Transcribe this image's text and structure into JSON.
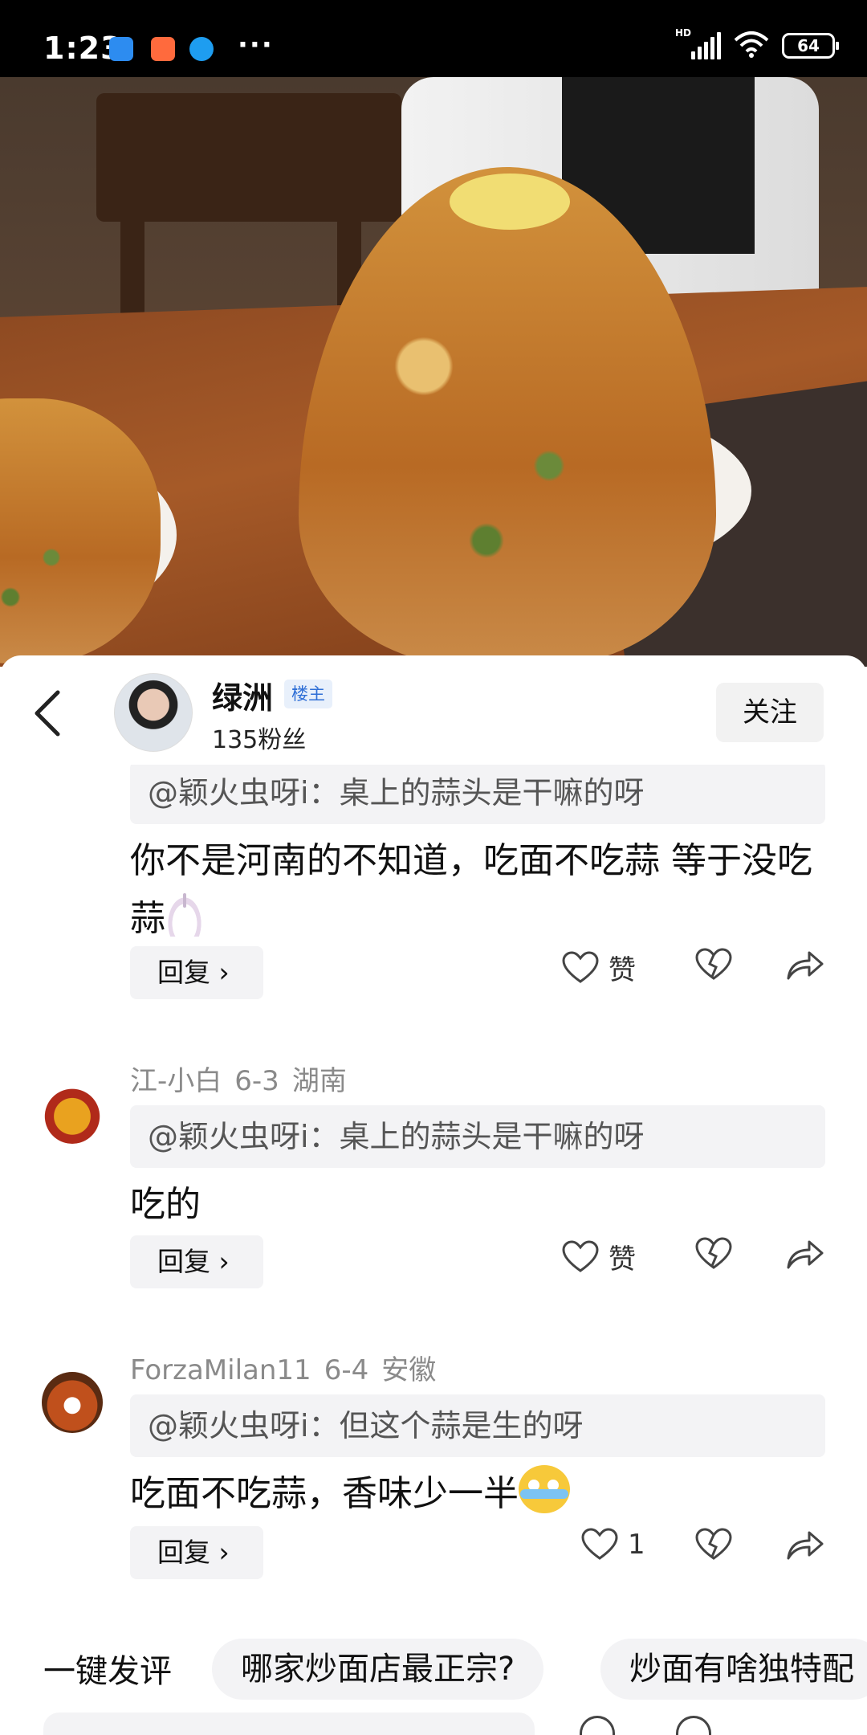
{
  "status_bar": {
    "time": "1:23",
    "network_label": "HD",
    "battery": "64",
    "overflow": "···"
  },
  "colors": {
    "owner_badge_bg": "#e8f0fb",
    "owner_badge_text": "#2f6fd6",
    "meta_gray": "#8a8a8a",
    "chip_bg": "#f3f3f5"
  },
  "header": {
    "author_name": "绿洲",
    "owner_badge": "楼主",
    "fans": "135粉丝",
    "follow_label": "关注"
  },
  "comments": [
    {
      "quote": "@颖火虫呀i：桌上的蒜头是干嘛的呀",
      "text": "你不是河南的不知道，吃面不吃蒜 等于没吃蒜",
      "emoji": "garlic-emoji",
      "reply_label": "回复",
      "like_label": "赞"
    },
    {
      "user": "江-小白",
      "date": "6-3",
      "location": "湖南",
      "quote": "@颖火虫呀i：桌上的蒜头是干嘛的呀",
      "text": "吃的",
      "reply_label": "回复",
      "like_label": "赞"
    },
    {
      "user": "ForzaMilan11",
      "date": "6-4",
      "location": "安徽",
      "quote": "@颖火虫呀i：但这个蒜是生的呀",
      "text": "吃面不吃蒜，香味少一半",
      "emoji": "crying-laughing-emoji",
      "reply_label": "回复",
      "like_count": "1"
    }
  ],
  "quick_comment": {
    "label": "一键发评",
    "chips": [
      "哪家炒面店最正宗?",
      "炒面有啥独特配"
    ]
  },
  "icons": [
    "back-chevron-icon",
    "heart-icon",
    "broken-heart-icon",
    "share-icon",
    "chevron-right-icon"
  ]
}
